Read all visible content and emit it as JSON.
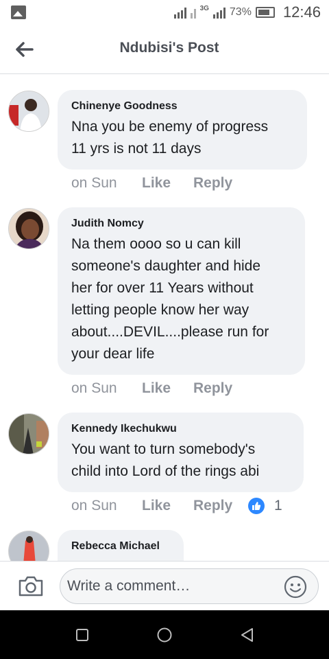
{
  "status_bar": {
    "network_label": "3G",
    "battery_percent": "73%",
    "time": "12:46"
  },
  "header": {
    "title": "Ndubisi's Post",
    "back_icon": "arrow-left-icon"
  },
  "comments": [
    {
      "author": "Chinenye Goodness",
      "text": "Nna you be enemy of progress\n11 yrs is not 11 days",
      "time": "on Sun",
      "like_label": "Like",
      "reply_label": "Reply"
    },
    {
      "author": "Judith Nomcy",
      "text": "Na them oooo so u can kill\nsomeone's daughter and hide\nher for  over 11 Years without\nletting people know  her way\nabout....DEVIL....please run for\nyour dear life",
      "time": "on Sun",
      "like_label": "Like",
      "reply_label": "Reply"
    },
    {
      "author": "Kennedy Ikechukwu",
      "text": "You want to turn somebody's\nchild into Lord of the rings abi",
      "time": "on Sun",
      "like_label": "Like",
      "reply_label": "Reply",
      "reaction_count": "1"
    },
    {
      "author": "Rebecca Michael",
      "text": "...",
      "time": "",
      "like_label": "",
      "reply_label": ""
    }
  ],
  "composer": {
    "placeholder": "Write a comment…",
    "camera_icon": "camera-icon",
    "emoji_icon": "emoji-icon"
  },
  "colors": {
    "bubble": "#f0f2f5",
    "meta_text": "#90949c",
    "like_blue": "#2d88ff"
  }
}
